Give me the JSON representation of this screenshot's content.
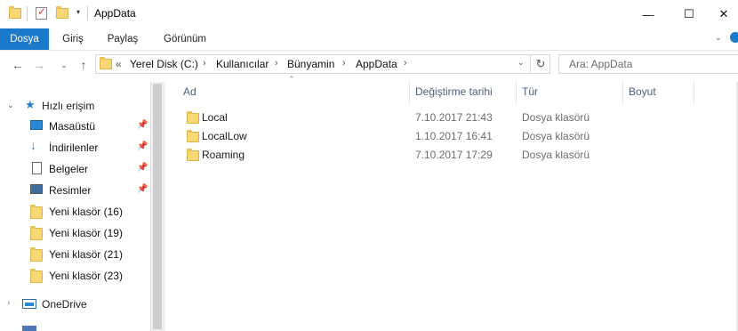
{
  "window": {
    "title": "AppData",
    "controls": {
      "minimize": "—",
      "maximize": "☐",
      "close": "✕"
    }
  },
  "ribbon": {
    "tabs": [
      {
        "label": "Dosya",
        "active": true
      },
      {
        "label": "Giriş"
      },
      {
        "label": "Paylaş"
      },
      {
        "label": "Görünüm"
      }
    ]
  },
  "address": {
    "overflow": "«",
    "crumbs": [
      "Yerel Disk (C:)",
      "Kullanıcılar",
      "Bünyamin",
      "AppData"
    ],
    "search_placeholder": "Ara: AppData"
  },
  "navpane": {
    "quick_access": "Hızlı erişim",
    "items": [
      {
        "label": "Masaüstü",
        "icon": "desktop-icon",
        "pinned": true
      },
      {
        "label": "İndirilenler",
        "icon": "downloads-icon",
        "pinned": true
      },
      {
        "label": "Belgeler",
        "icon": "documents-icon",
        "pinned": true
      },
      {
        "label": "Resimler",
        "icon": "pictures-icon",
        "pinned": true
      },
      {
        "label": "Yeni klasör (16)",
        "icon": "folder-icon"
      },
      {
        "label": "Yeni klasör (19)",
        "icon": "folder-icon"
      },
      {
        "label": "Yeni klasör (21)",
        "icon": "folder-icon"
      },
      {
        "label": "Yeni klasör (23)",
        "icon": "folder-icon"
      }
    ],
    "onedrive": "OneDrive"
  },
  "columns": {
    "name": "Ad",
    "modified": "Değiştirme tarihi",
    "type": "Tür",
    "size": "Boyut"
  },
  "files": [
    {
      "name": "Local",
      "modified": "7.10.2017 21:43",
      "type": "Dosya klasörü"
    },
    {
      "name": "LocalLow",
      "modified": "1.10.2017 16:41",
      "type": "Dosya klasörü"
    },
    {
      "name": "Roaming",
      "modified": "7.10.2017 17:29",
      "type": "Dosya klasörü"
    }
  ]
}
